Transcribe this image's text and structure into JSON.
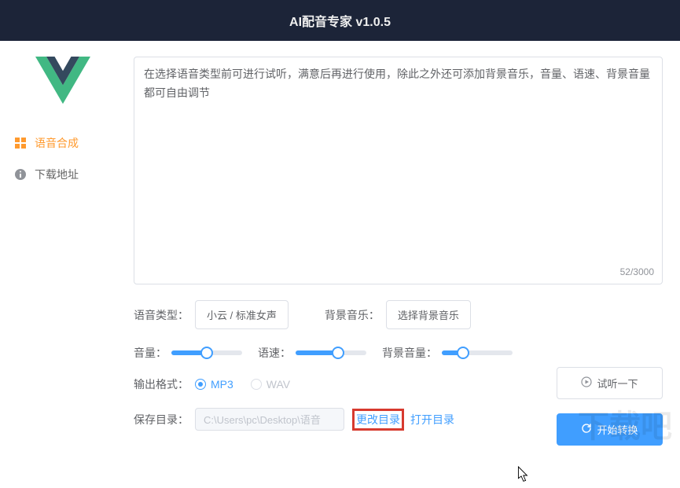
{
  "header": {
    "title": "AI配音专家 v1.0.5"
  },
  "sidebar": {
    "items": [
      {
        "label": "语音合成",
        "icon": "grid",
        "active": true
      },
      {
        "label": "下载地址",
        "icon": "info",
        "active": false
      }
    ]
  },
  "main": {
    "text_value": "在选择语音类型前可进行试听，满意后再进行使用，除此之外还可添加背景音乐，音量、语速、背景音量都可自由调节",
    "char_count": "52/3000",
    "voice_type_label": "语音类型：",
    "voice_type_value": "小云 / 标准女声",
    "bg_music_label": "背景音乐：",
    "bg_music_value": "选择背景音乐",
    "volume_label": "音量：",
    "speed_label": "语速：",
    "bg_volume_label": "背景音量：",
    "volume_pct": 50,
    "speed_pct": 60,
    "bg_volume_pct": 30,
    "output_format_label": "输出格式：",
    "format_options": [
      {
        "label": "MP3",
        "checked": true
      },
      {
        "label": "WAV",
        "checked": false
      }
    ],
    "save_dir_label": "保存目录：",
    "save_dir_value": "C:\\Users\\pc\\Desktop\\语音",
    "change_dir_label": "更改目录",
    "open_dir_label": "打开目录",
    "preview_label": "试听一下",
    "convert_label": "开始转换"
  },
  "watermark": "下载吧"
}
